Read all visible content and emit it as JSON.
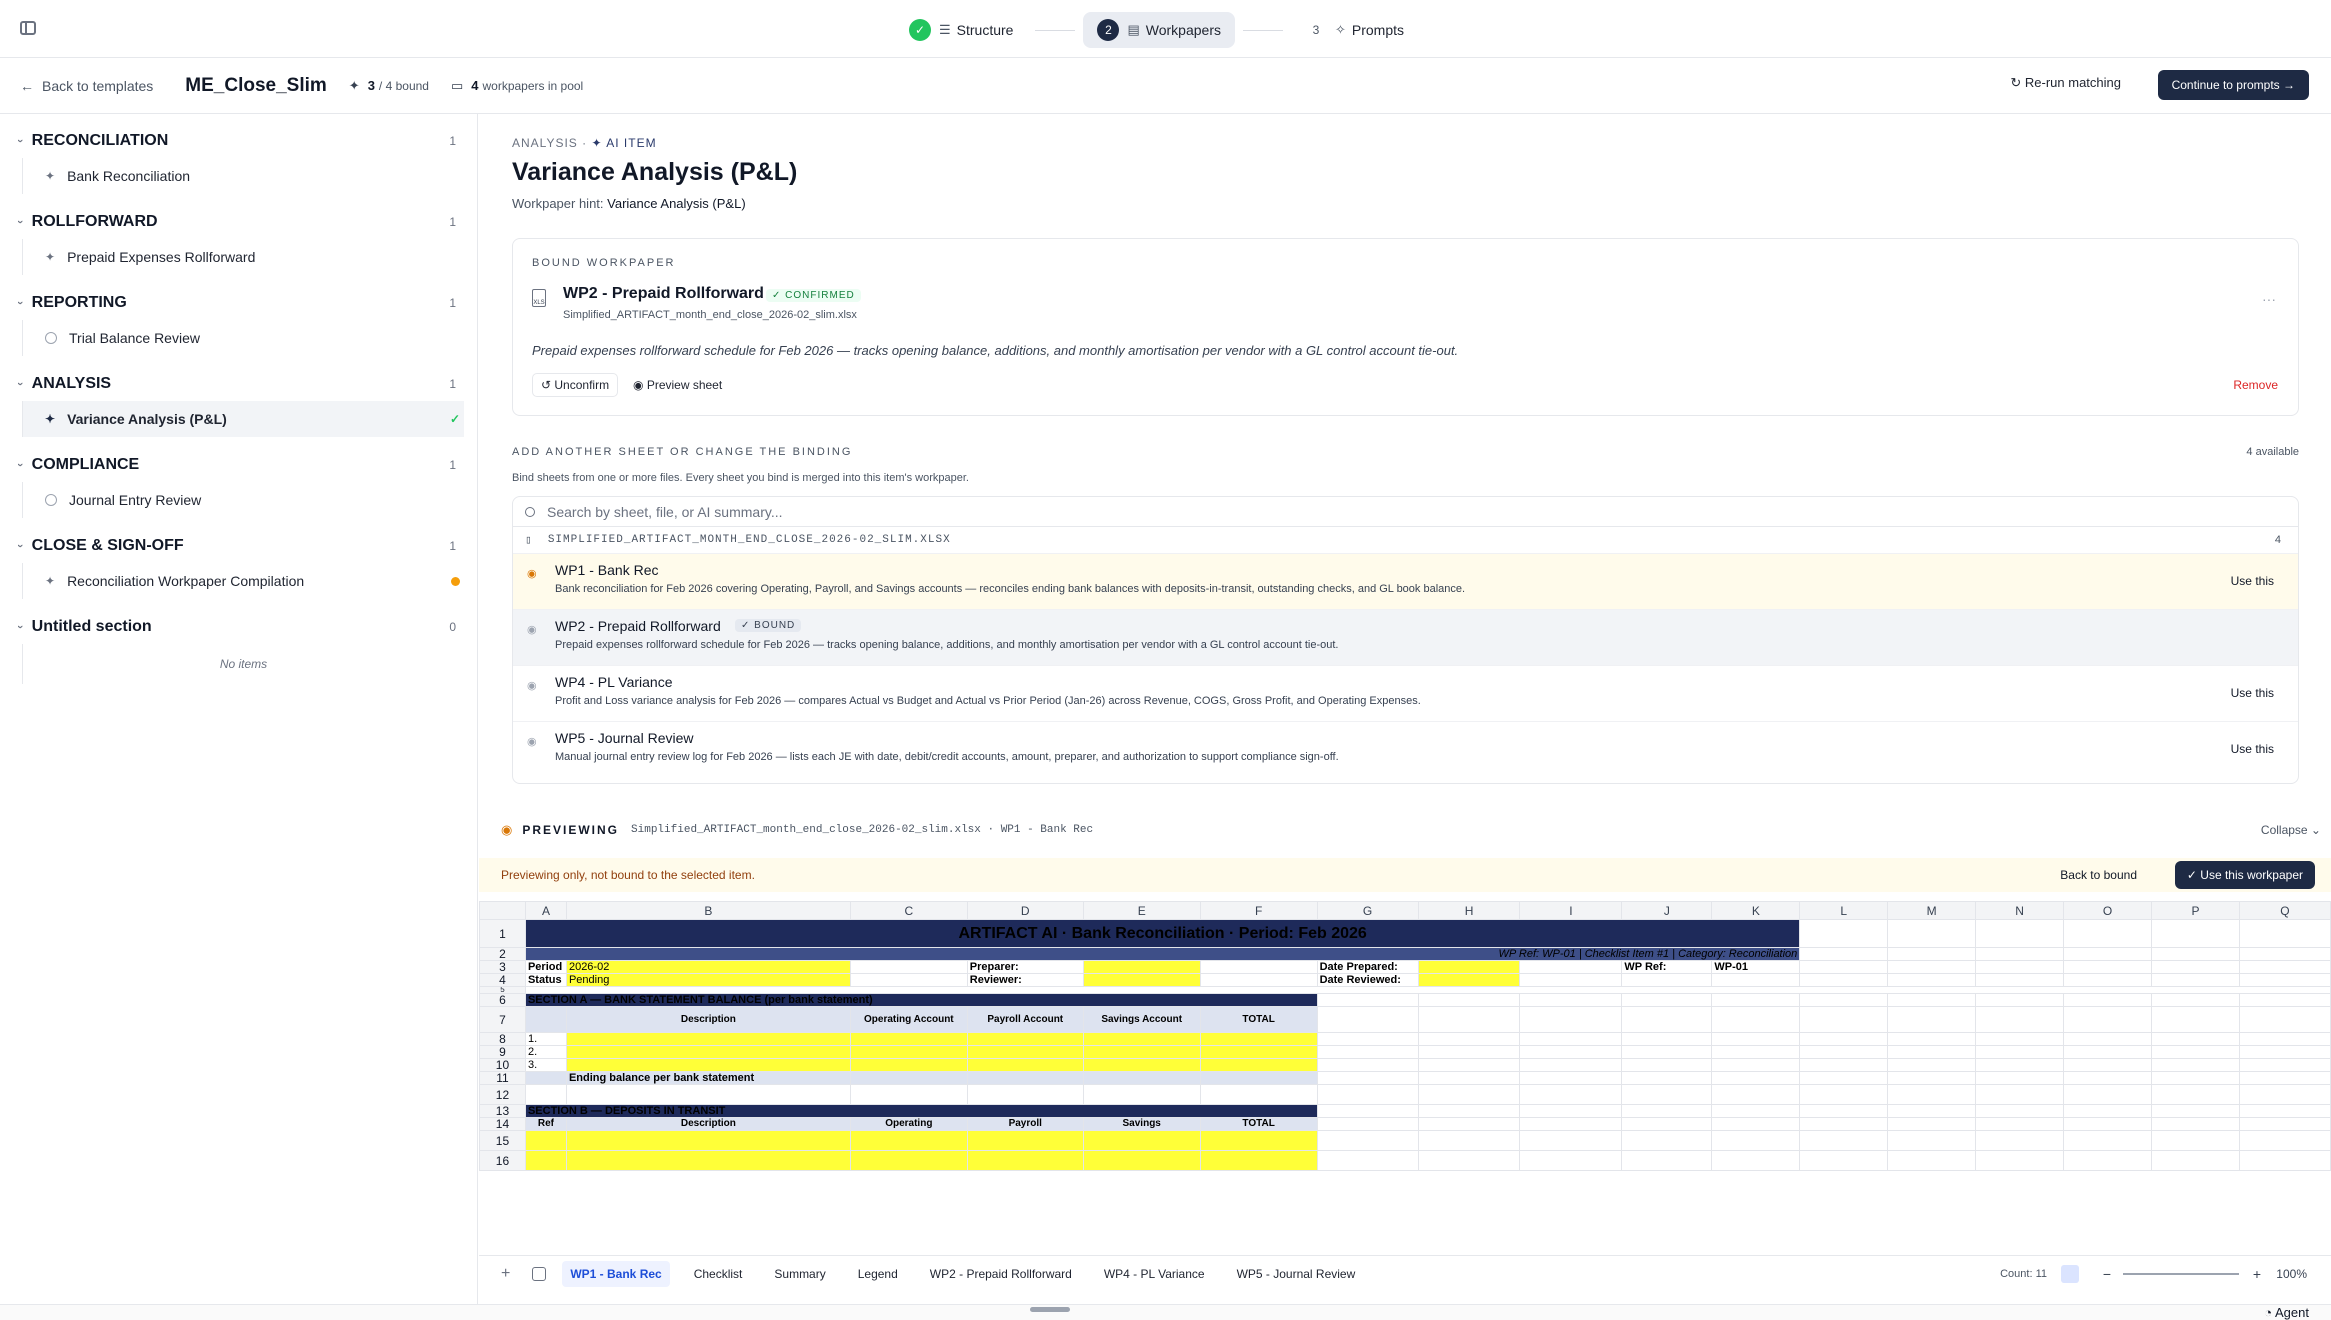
{
  "steps": [
    {
      "num": "✓",
      "label": "Structure",
      "icon": "list-icon"
    },
    {
      "num": "2",
      "label": "Workpapers",
      "icon": "document-icon"
    },
    {
      "num": "3",
      "label": "Prompts",
      "icon": "sparkle-icon"
    }
  ],
  "header": {
    "back_label": "Back to templates",
    "template_name": "ME_Close_Slim",
    "bound_count": "3",
    "bound_total": "/ 4 bound",
    "pool_count": "4",
    "pool_label": "workpapers in pool",
    "rerun_label": "Re-run matching",
    "continue_label": "Continue to prompts →"
  },
  "sidebar": {
    "sections": [
      {
        "title": "RECONCILIATION",
        "count": "1",
        "items": [
          {
            "label": "Bank Reconciliation",
            "icon": "sparkle-icon"
          }
        ]
      },
      {
        "title": "ROLLFORWARD",
        "count": "1",
        "items": [
          {
            "label": "Prepaid Expenses Rollforward",
            "icon": "sparkle-icon"
          }
        ]
      },
      {
        "title": "REPORTING",
        "count": "1",
        "items": [
          {
            "label": "Trial Balance Review",
            "icon": "user-icon"
          }
        ]
      },
      {
        "title": "ANALYSIS",
        "count": "1",
        "items": [
          {
            "label": "Variance Analysis (P&L)",
            "icon": "sparkle-icon"
          }
        ]
      },
      {
        "title": "COMPLIANCE",
        "count": "1",
        "items": [
          {
            "label": "Journal Entry Review",
            "icon": "user-icon"
          }
        ]
      },
      {
        "title": "CLOSE & SIGN-OFF",
        "count": "1",
        "items": [
          {
            "label": "Reconciliation Workpaper Compilation",
            "icon": "sparkle-icon"
          }
        ]
      },
      {
        "title": "Untitled section",
        "count": "0",
        "empty": "No items"
      }
    ]
  },
  "main": {
    "crumb_section": "ANALYSIS",
    "crumb_ai": "AI ITEM",
    "title": "Variance Analysis (P&L)",
    "hint_label": "Workpaper hint:",
    "hint_value": "Variance Analysis (P&L)",
    "bound": {
      "label": "BOUND WORKPAPER",
      "name": "WP2 - Prepaid Rollforward",
      "status": "✓ CONFIRMED",
      "file": "Simplified_ARTIFACT_month_end_close_2026-02_slim.xlsx",
      "description": "Prepaid expenses rollforward schedule for Feb 2026 — tracks opening balance, additions, and monthly amortisation per vendor with a GL control account tie-out.",
      "unconfirm": "Unconfirm",
      "preview": "Preview sheet",
      "remove": "Remove"
    },
    "add": {
      "heading": "ADD ANOTHER SHEET OR CHANGE THE BINDING",
      "available": "4 available",
      "subtitle": "Bind sheets from one or more files. Every sheet you bind is merged into this item's workpaper.",
      "search_placeholder": "Search by sheet, file, or AI summary...",
      "file_name": "SIMPLIFIED_ARTIFACT_MONTH_END_CLOSE_2026-02_SLIM.XLSX",
      "file_count": "4",
      "use_label": "Use this",
      "bound_badge": "✓ BOUND",
      "rows": [
        {
          "name": "WP1 - Bank Rec",
          "desc": "Bank reconciliation for Feb 2026 covering Operating, Payroll, and Savings accounts — reconciles ending bank balances with deposits-in-transit, outstanding checks, and GL book balance."
        },
        {
          "name": "WP2 - Prepaid Rollforward",
          "desc": "Prepaid expenses rollforward schedule for Feb 2026 — tracks opening balance, additions, and monthly amortisation per vendor with a GL control account tie-out."
        },
        {
          "name": "WP4 - PL Variance",
          "desc": "Profit and Loss variance analysis for Feb 2026 — compares Actual vs Budget and Actual vs Prior Period (Jan-26) across Revenue, COGS, Gross Profit, and Operating Expenses."
        },
        {
          "name": "WP5 - Journal Review",
          "desc": "Manual journal entry review log for Feb 2026 — lists each JE with date, debit/credit accounts, amount, preparer, and authorization to support compliance sign-off."
        }
      ]
    },
    "preview": {
      "label": "PREVIEWING",
      "file": "Simplified_ARTIFACT_month_end_close_2026-02_slim.xlsx · WP1 - Bank Rec",
      "collapse": "Collapse ⌄",
      "notice": "Previewing only, not bound to the selected item.",
      "back_to_bound": "Back to bound",
      "use_workpaper": "✓ Use this workpaper"
    },
    "sheet": {
      "columns": [
        "A",
        "B",
        "C",
        "D",
        "E",
        "F",
        "G",
        "H",
        "I",
        "J",
        "K",
        "L",
        "M",
        "N",
        "O",
        "P",
        "Q"
      ],
      "banner": "ARTIFACT AI · Bank Reconciliation · Period: Feb 2026",
      "subbanner": "WP Ref: WP-01  |  Checklist Item #1  |  Category: Reconciliation",
      "period_label": "Period",
      "period_value": "2026-02",
      "status_label": "Status",
      "status_value": "Pending",
      "preparer": "Preparer:",
      "reviewer": "Reviewer:",
      "date_prepared": "Date Prepared:",
      "date_reviewed": "Date Reviewed:",
      "wp_ref_label": "WP Ref:",
      "wp_ref_value": "WP-01",
      "section_a": "SECTION A — BANK STATEMENT BALANCE (per bank statement)",
      "h_description": "Description",
      "h_operating_account": "Operating Account",
      "h_payroll_account": "Payroll Account",
      "h_savings_account": "Savings Account",
      "h_total": "TOTAL",
      "line1": "1.",
      "line2": "2.",
      "line3": "3.",
      "ending": "Ending balance per bank statement",
      "section_b": "SECTION B — DEPOSITS IN TRANSIT",
      "h_ref": "Ref",
      "h_operating": "Operating",
      "h_payroll": "Payroll",
      "h_savings": "Savings"
    },
    "tabs": [
      "WP1 - Bank Rec",
      "Checklist",
      "Summary",
      "Legend",
      "WP2 - Prepaid Rollforward",
      "WP4 - PL Variance",
      "WP5 - Journal Review"
    ],
    "status_count": "Count: 11",
    "zoom": "100%"
  },
  "agent_label": "Agent",
  "colors": {
    "accent": "#1e2a44",
    "banner": "#1e2a5a",
    "yellow": "#ffff38",
    "success": "#22c55e",
    "warning": "#f59e0b"
  }
}
